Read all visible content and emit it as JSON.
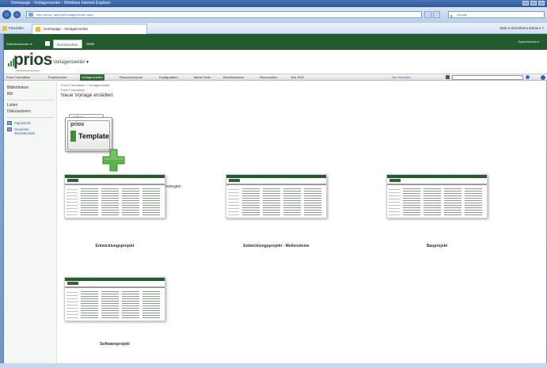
{
  "browser": {
    "title": "Homepage - Vorlagencenter - Windows Internet Explorer",
    "url": "http://prios/_layouts/Vorlagencenter.aspx",
    "search_placeholder": "Google",
    "favorites_label": "Favoriten",
    "tab_label": "Homepage - Vorlagencenter",
    "command_bar": "Seite ▾  Sicherheit ▾  Extras ▾  ?"
  },
  "sharepoint": {
    "site_actions": "Websiteaktionen ▾",
    "nav_tabs": [
      "Durchsuchen",
      "Seite"
    ],
    "user": "Systemkonto ▾",
    "logo_text": "prios",
    "page_heading": "Vorlagencenter ▾"
  },
  "topnav": {
    "items": [
      "Prios Foundation",
      "Projektcenter",
      "Vorlagencenter",
      "Ressourcenpool",
      "Konfiguration",
      "Meine Seite",
      "Berichtswesen",
      "Ökonometer",
      "Test SSO"
    ],
    "active_index": 2,
    "search_scope": "Alle Websites"
  },
  "quicklaunch": {
    "items": [
      "Bibliotheken",
      "Bilt"
    ],
    "items2": [
      "Listen",
      "Diskussionen"
    ],
    "links": [
      "Papierkorb",
      "Gesamter Websiteinhalt"
    ]
  },
  "breadcrumb": "Prios Foundation > Vorlagencenter",
  "breadcrumb2": "Prios Foundation",
  "main_title": "Neue Vorlage erstellen",
  "template_tile": {
    "brand": "prios",
    "label": "Template",
    "caption": "Neue Projektvorlage erzeugen"
  },
  "templates": [
    {
      "caption": "Entwicklungsprojekt"
    },
    {
      "caption": "Entwicklungsprojekt - Meilensteine"
    },
    {
      "caption": "Bauprojekt"
    },
    {
      "caption": "Softwareprojekt"
    }
  ],
  "colors": {
    "sharepoint_green": "#235a2e",
    "ie_blue": "#2d5aa0",
    "plus_green": "#5bb54a"
  }
}
